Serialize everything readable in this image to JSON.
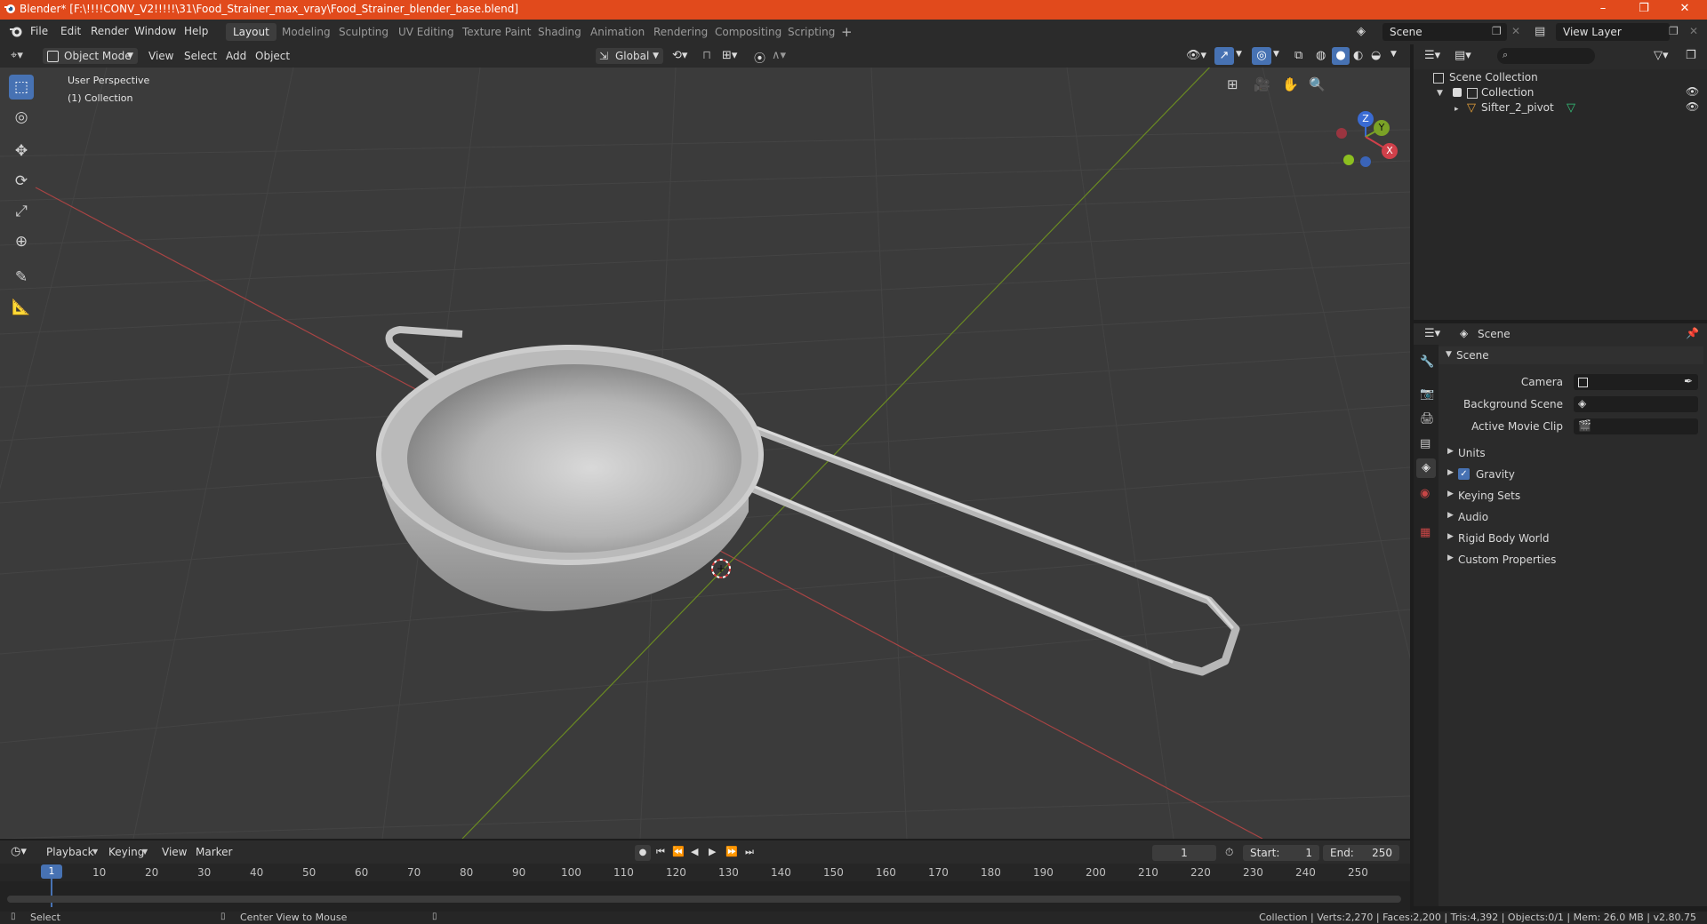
{
  "titlebar": {
    "title": "Blender* [F:\\!!!!CONV_V2!!!!!\\31\\Food_Strainer_max_vray\\Food_Strainer_blender_base.blend]",
    "minimize": "–",
    "maximize": "❐",
    "close": "✕"
  },
  "menu": [
    "File",
    "Edit",
    "Render",
    "Window",
    "Help"
  ],
  "workspaces": [
    "Layout",
    "Modeling",
    "Sculpting",
    "UV Editing",
    "Texture Paint",
    "Shading",
    "Animation",
    "Rendering",
    "Compositing",
    "Scripting"
  ],
  "active_workspace": "Layout",
  "scene_name": "Scene",
  "view_layer": "View Layer",
  "viewport_header": {
    "mode": "Object Mode",
    "view": "View",
    "select": "Select",
    "add": "Add",
    "object": "Object",
    "orientation": "Global"
  },
  "viewport": {
    "perspective": "User Perspective",
    "collection": "(1) Collection",
    "gizmo_labels": {
      "z": "Z",
      "y": "Y",
      "x": "X"
    }
  },
  "outliner": {
    "root": "Scene Collection",
    "collection": "Collection",
    "object": "Sifter_2_pivot"
  },
  "properties": {
    "header": "Scene",
    "panel_title": "Scene",
    "camera_label": "Camera",
    "background_scene_label": "Background Scene",
    "active_movie_clip_label": "Active Movie Clip",
    "sections": [
      "Units",
      "Gravity",
      "Keying Sets",
      "Audio",
      "Rigid Body World",
      "Custom Properties"
    ],
    "gravity_checked": true
  },
  "timeline": {
    "menus": [
      "Playback",
      "Keying",
      "View",
      "Marker"
    ],
    "current_frame": "1",
    "start_label": "Start:",
    "start": "1",
    "end_label": "End:",
    "end": "250",
    "ticks": [
      "1",
      "10",
      "20",
      "30",
      "40",
      "50",
      "60",
      "70",
      "80",
      "90",
      "100",
      "110",
      "120",
      "130",
      "140",
      "150",
      "160",
      "170",
      "180",
      "190",
      "200",
      "210",
      "220",
      "230",
      "240",
      "250"
    ]
  },
  "statusbar": {
    "left_action": "Select",
    "middle_action": "Center View to Mouse",
    "stats": "Collection | Verts:2,270 | Faces:2,200 | Tris:4,392 | Objects:0/1 | Mem: 26.0 MB | v2.80.75"
  },
  "colors": {
    "titlebar": "#e14a1c",
    "accent_blue": "#4772b3",
    "x_axis": "#c84646",
    "y_axis": "#7a9a2a",
    "object_orange": "#e8a13a"
  }
}
